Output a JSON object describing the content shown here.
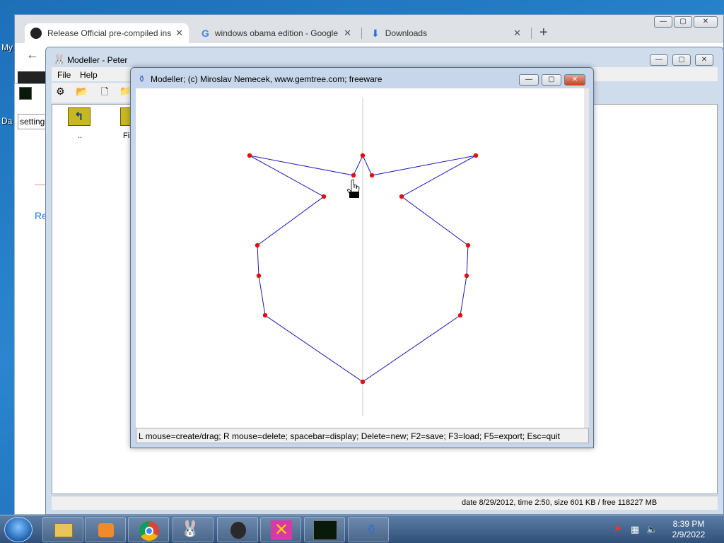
{
  "desktop": {
    "label_top": "My",
    "label_mid": "Da"
  },
  "chrome": {
    "tabs": [
      {
        "title": "Release Official pre-compiled ins",
        "icon": "github-icon",
        "active": true
      },
      {
        "title": "windows obama edition - Google",
        "icon": "google-icon",
        "active": false
      },
      {
        "title": "Downloads",
        "icon": "download-icon",
        "active": false
      }
    ],
    "new_tab": "+",
    "window_controls": [
      "—",
      "▢",
      "✕"
    ],
    "partial_input": "setting",
    "partial_text": "Re"
  },
  "peter": {
    "title": "Modeller - Peter",
    "menu": [
      "File",
      "Help"
    ],
    "folder_up_label": "..",
    "folder_label": "Fi",
    "status": "date 8/29/2012, time 2:50, size 601 KB / free 118227 MB"
  },
  "modeller": {
    "title": "Modeller;   (c) Miroslav Nemecek, www.gemtree.com;   freeware",
    "status": "L mouse=create/drag; R mouse=delete; spacebar=display; Delete=new; F2=save; F3=load; F5=export; Esc=quit",
    "colors": {
      "line": "#1a1ab4",
      "point": "#e01010",
      "axis": "#c8c8c8"
    },
    "shape_points": [
      [
        512,
        219
      ],
      [
        525,
        247
      ],
      [
        672,
        219
      ],
      [
        567,
        277
      ],
      [
        661,
        346
      ],
      [
        659,
        389
      ],
      [
        650,
        445
      ],
      [
        512,
        539
      ],
      [
        374,
        445
      ],
      [
        365,
        389
      ],
      [
        363,
        346
      ],
      [
        457,
        277
      ],
      [
        352,
        219
      ],
      [
        499,
        247
      ]
    ]
  },
  "taskbar": {
    "time": "8:39 PM",
    "date": "2/9/2022",
    "pinned": [
      "explorer-icon",
      "media-player-icon",
      "chrome-icon",
      "bunny-app-icon",
      "alien-app-icon",
      "x-app-icon",
      "oscilloscope-icon",
      "vase-modeller-icon"
    ]
  }
}
